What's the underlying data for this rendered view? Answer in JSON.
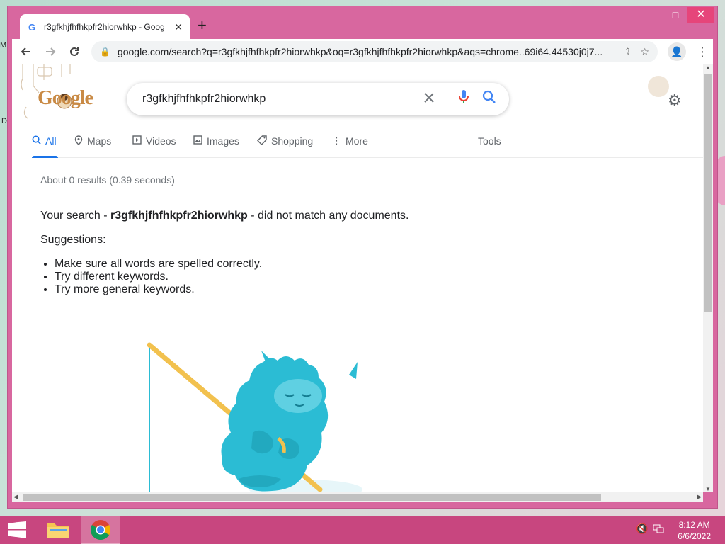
{
  "desktop": {
    "edge_text_1": "M",
    "edge_text_2": "D"
  },
  "window": {
    "tab_title": "r3gfkhjfhfhkpfr2hiorwhkp - Goog",
    "new_tab": "+",
    "controls": {
      "minimize": "–",
      "maximize": "□",
      "close": "✕"
    }
  },
  "toolbar": {
    "url": "google.com/search?q=r3gfkhjfhfhkpfr2hiorwhkp&oq=r3gfkhjfhfhkpfr2hiorwhkp&aqs=chrome..69i64.44530j0j7..."
  },
  "search": {
    "query": "r3gfkhjfhfhkpfr2hiorwhkp",
    "doodle_text": "Google",
    "tabs": [
      {
        "label": "All",
        "icon": "search-icon",
        "active": true
      },
      {
        "label": "Maps",
        "icon": "map-pin-icon"
      },
      {
        "label": "Videos",
        "icon": "video-icon"
      },
      {
        "label": "Images",
        "icon": "image-icon"
      },
      {
        "label": "Shopping",
        "icon": "tag-icon"
      },
      {
        "label": "More",
        "icon": "more-vert-icon"
      }
    ],
    "tools_label": "Tools",
    "stats": "About 0 results (0.39 seconds)",
    "message_prefix": "Your search - ",
    "message_query": "r3gfkhjfhfhkpfr2hiorwhkp",
    "message_suffix": " - did not match any documents.",
    "suggestions_heading": "Suggestions:",
    "suggestions": [
      "Make sure all words are spelled correctly.",
      "Try different keywords.",
      "Try more general keywords."
    ]
  },
  "taskbar": {
    "clock_time": "8:12 AM",
    "clock_date": "6/6/2022"
  },
  "colors": {
    "window_frame": "#d8679f",
    "taskbar": "#c8467f",
    "accent_blue": "#1a73e8",
    "illustration": "#2bbcd4"
  }
}
